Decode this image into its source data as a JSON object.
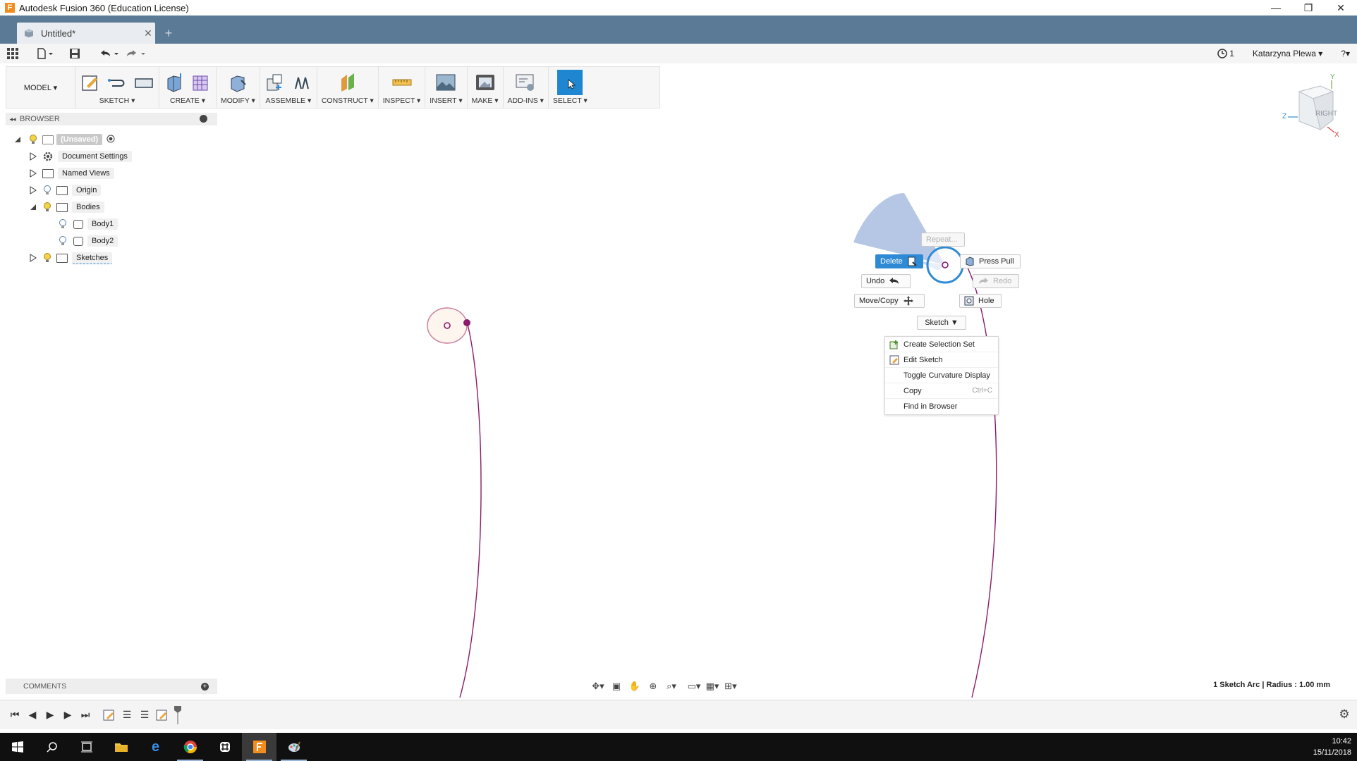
{
  "window": {
    "title": "Autodesk Fusion 360 (Education License)",
    "controls": [
      "—",
      "❐",
      "✕"
    ]
  },
  "tabs": {
    "active_title": "Untitled*",
    "close_glyph": "✕",
    "new_glyph": "+"
  },
  "quick_access": {
    "jobs_count": "1",
    "user": "Katarzyna Plewa ▾",
    "help": "?▾"
  },
  "ribbon": {
    "mode": "MODEL ▾",
    "groups": [
      {
        "label": "SKETCH ▾"
      },
      {
        "label": "CREATE ▾"
      },
      {
        "label": "MODIFY ▾"
      },
      {
        "label": "ASSEMBLE ▾"
      },
      {
        "label": "CONSTRUCT ▾"
      },
      {
        "label": "INSPECT ▾"
      },
      {
        "label": "INSERT ▾"
      },
      {
        "label": "MAKE ▾"
      },
      {
        "label": "ADD-INS ▾"
      },
      {
        "label": "SELECT ▾"
      }
    ]
  },
  "browser": {
    "title": "BROWSER",
    "items": [
      {
        "label": "(Unsaved)"
      },
      {
        "label": "Document Settings"
      },
      {
        "label": "Named Views"
      },
      {
        "label": "Origin"
      },
      {
        "label": "Bodies"
      },
      {
        "label": "Body1"
      },
      {
        "label": "Body2"
      },
      {
        "label": "Sketches"
      }
    ]
  },
  "marking_menu": {
    "repeat": "Repeat...",
    "delete": "Delete",
    "press_pull": "Press Pull",
    "undo": "Undo",
    "redo": "Redo",
    "move_copy": "Move/Copy",
    "hole": "Hole",
    "sketch": "Sketch ▼"
  },
  "context_menu": {
    "items": [
      {
        "label": "Create Selection Set",
        "shortcut": ""
      },
      {
        "label": "Edit Sketch",
        "shortcut": ""
      },
      {
        "label": "Toggle Curvature Display",
        "shortcut": ""
      },
      {
        "label": "Copy",
        "shortcut": "Ctrl+C"
      },
      {
        "label": "Find in Browser",
        "shortcut": ""
      }
    ]
  },
  "viewcube": {
    "face": "RIGHT",
    "axis_x": "X",
    "axis_y": "Y",
    "axis_z": "Z"
  },
  "comments": {
    "title": "COMMENTS",
    "plus": "+"
  },
  "status": {
    "selection": "1 Sketch Arc | Radius : 1.00 mm"
  },
  "taskbar": {
    "time": "10:42",
    "date": "15/11/2018"
  },
  "colors": {
    "tabbar": "#5a7a96",
    "select_active": "#1f86d1",
    "sketch_curve": "#8b1a6b",
    "marking_menu_pie": "#a9bde0"
  }
}
